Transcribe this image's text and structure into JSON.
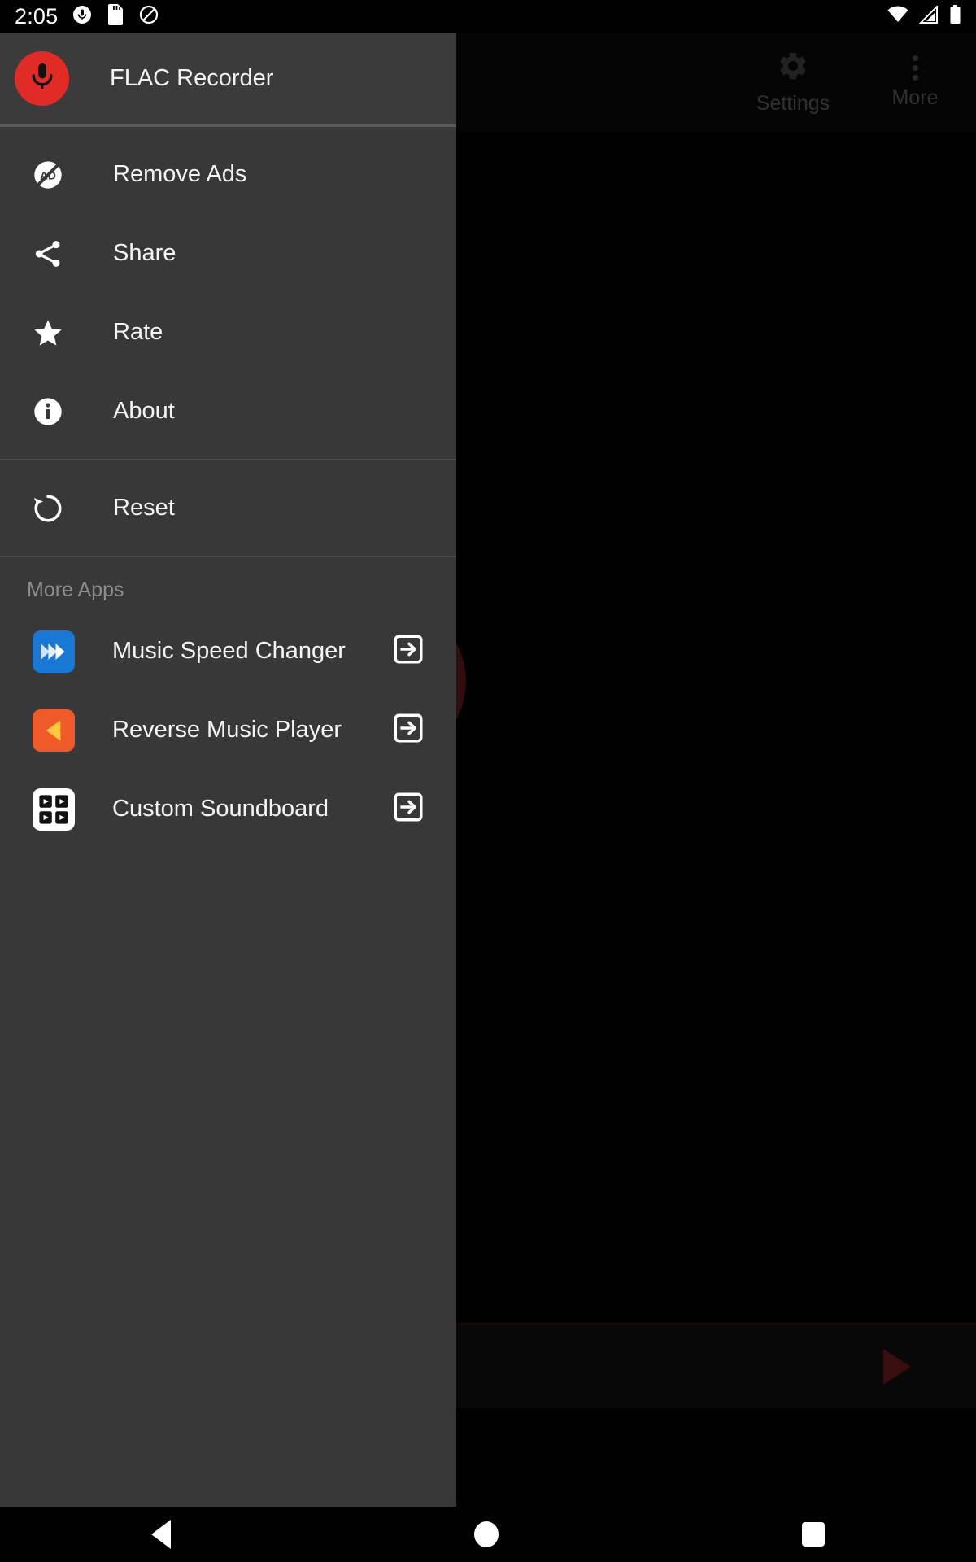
{
  "status_bar": {
    "time": "2:05",
    "left_icons": [
      "microphone-recording-icon",
      "sd-card-icon",
      "do-not-disturb-icon"
    ],
    "right_icons": [
      "wifi-icon",
      "cell-signal-icon",
      "battery-icon"
    ]
  },
  "app_bar": {
    "settings_label": "Settings",
    "more_label": "More"
  },
  "drawer": {
    "header": {
      "title": "FLAC Recorder",
      "logo_icon": "microphone-icon",
      "logo_color": "#e12b26"
    },
    "menu_items": [
      {
        "label": "Remove Ads",
        "icon": "remove-ads-icon"
      },
      {
        "label": "Share",
        "icon": "share-icon"
      },
      {
        "label": "Rate",
        "icon": "star-icon"
      },
      {
        "label": "About",
        "icon": "info-icon"
      }
    ],
    "reset_item": {
      "label": "Reset",
      "icon": "restore-icon"
    },
    "more_apps_title": "More Apps",
    "more_apps": [
      {
        "label": "Music Speed Changer",
        "icon": "fast-forward-icon",
        "icon_bg": "#1878d4",
        "action_icon": "open-in-app-icon"
      },
      {
        "label": "Reverse Music Player",
        "icon": "reverse-play-icon",
        "icon_bg": "#f05a2a",
        "action_icon": "open-in-app-icon"
      },
      {
        "label": "Custom Soundboard",
        "icon": "soundboard-grid-icon",
        "icon_bg": "#ffffff",
        "action_icon": "open-in-app-icon"
      }
    ]
  },
  "main": {
    "record_button_icon": "microphone-icon",
    "record_button_color": "#6e1d1d",
    "play_button_icon": "play-icon",
    "play_button_color": "#7d1f21"
  },
  "nav_bar": {
    "back_label": "Back",
    "home_label": "Home",
    "recents_label": "Recents"
  }
}
